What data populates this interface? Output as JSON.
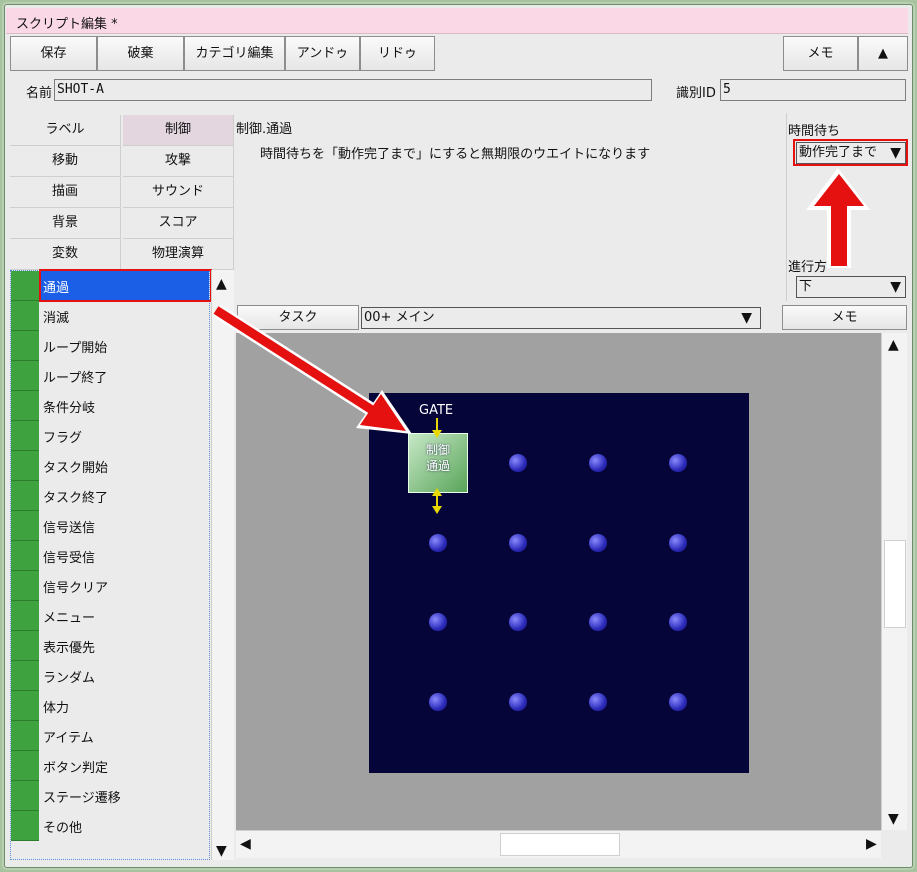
{
  "window": {
    "title": "スクリプト編集 *"
  },
  "toolbar": {
    "save": "保存",
    "discard": "破棄",
    "category_edit": "カテゴリ編集",
    "undo": "アンドゥ",
    "redo": "リドゥ",
    "memo": "メモ",
    "up": "▲"
  },
  "meta": {
    "name_label": "名前",
    "name_value": "SHOT-A",
    "id_label": "識別ID",
    "id_value": "5"
  },
  "categories": [
    {
      "label": "ラベル"
    },
    {
      "label": "制御",
      "selected": true
    },
    {
      "label": "移動"
    },
    {
      "label": "攻撃"
    },
    {
      "label": "描画"
    },
    {
      "label": "サウンド"
    },
    {
      "label": "背景"
    },
    {
      "label": "スコア"
    },
    {
      "label": "変数"
    },
    {
      "label": "物理演算"
    }
  ],
  "commands": [
    {
      "label": "通過",
      "selected": true
    },
    {
      "label": "消滅"
    },
    {
      "label": "ループ開始"
    },
    {
      "label": "ループ終了"
    },
    {
      "label": "条件分岐"
    },
    {
      "label": "フラグ"
    },
    {
      "label": "タスク開始"
    },
    {
      "label": "タスク終了"
    },
    {
      "label": "信号送信"
    },
    {
      "label": "信号受信"
    },
    {
      "label": "信号クリア"
    },
    {
      "label": "メニュー"
    },
    {
      "label": "表示優先"
    },
    {
      "label": "ランダム"
    },
    {
      "label": "体力"
    },
    {
      "label": "アイテム"
    },
    {
      "label": "ボタン判定"
    },
    {
      "label": "ステージ遷移"
    },
    {
      "label": "その他"
    }
  ],
  "detail": {
    "title": "制御.通過",
    "description": "時間待ちを「動作完了まで」にすると無期限のウエイトになります"
  },
  "properties": {
    "wait_label": "時間待ち",
    "wait_value": "動作完了まで",
    "direction_label": "進行方",
    "direction_value": "下"
  },
  "task_bar": {
    "task_button": "タスク",
    "task_select": "00+ メイン",
    "memo_button": "メモ"
  },
  "canvas": {
    "gate_label": "GATE",
    "block_line1": "制御",
    "block_line2": "通過"
  },
  "icons": {
    "dropdown": "▼",
    "up": "▲",
    "down": "▼",
    "left": "◀",
    "right": "▶"
  },
  "colors": {
    "accent_red": "#e51010",
    "selection_blue": "#1a5fe6",
    "green_marker": "#3ea33e",
    "board_bg": "#05053a",
    "title_bg": "#fad8e6"
  }
}
